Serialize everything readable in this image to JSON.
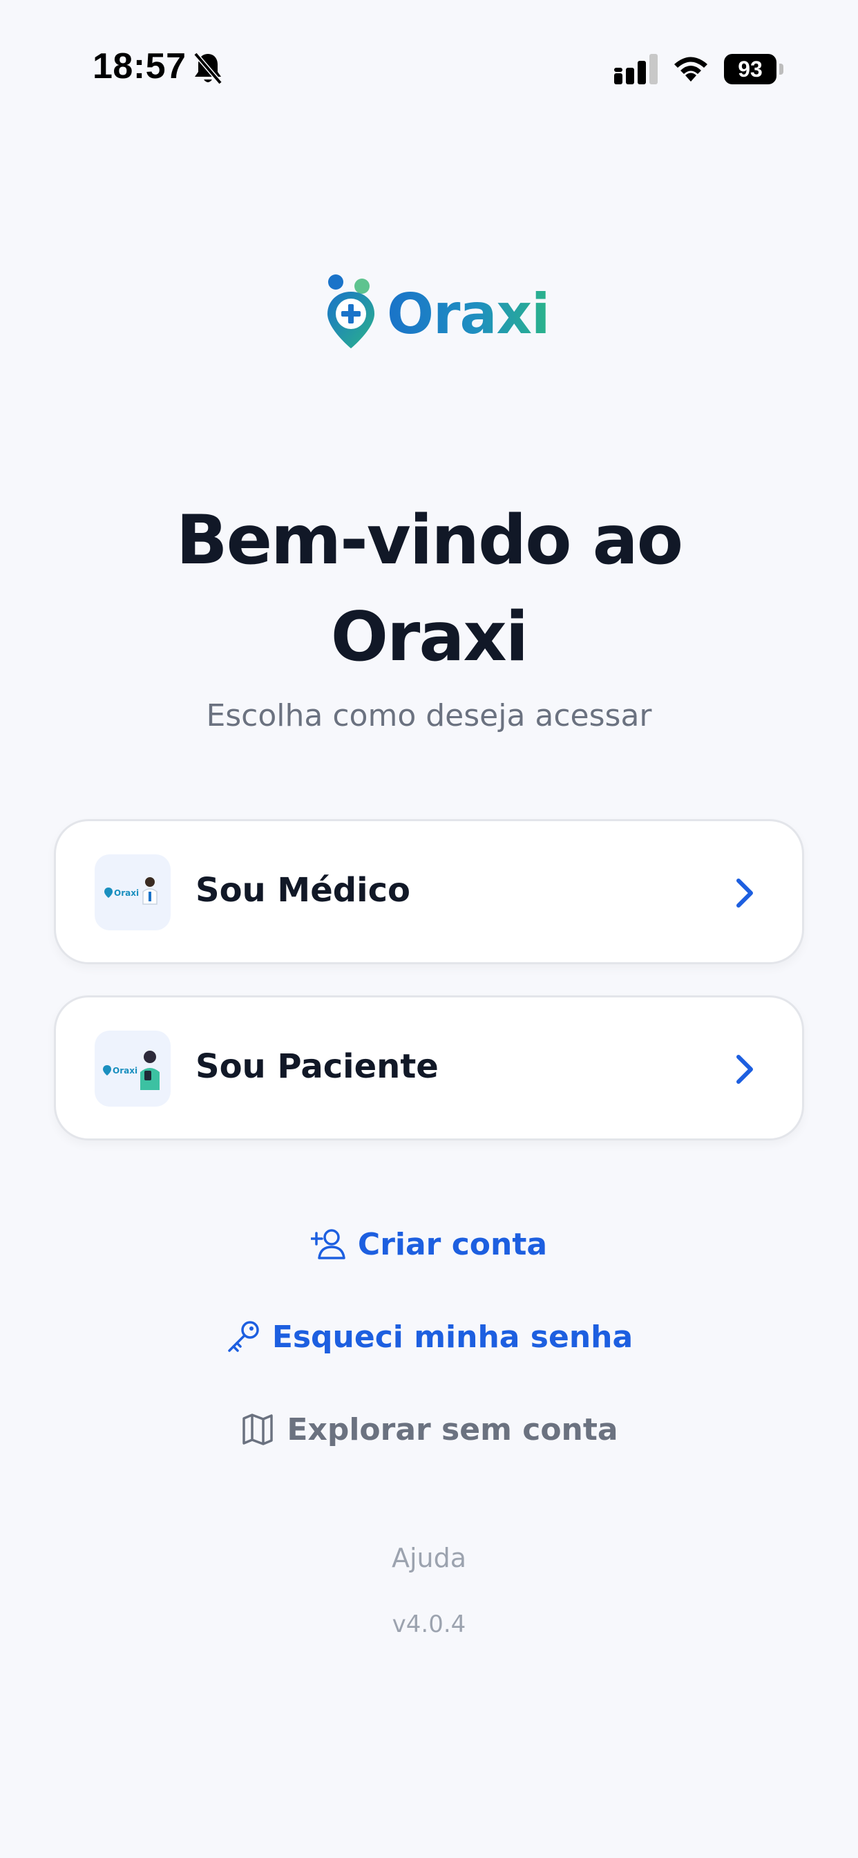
{
  "status_bar": {
    "time": "18:57",
    "battery": "93",
    "icons": [
      "bell-off-icon",
      "cellular-signal-icon",
      "wifi-icon",
      "battery-icon"
    ]
  },
  "brand": {
    "name": "Oraxi",
    "logo_icon": "location-pin-plus-icon",
    "colors": {
      "primary": "#1a73c9",
      "accent": "#2bb38a"
    }
  },
  "welcome": {
    "title_line1": "Bem-vindo ao",
    "title_line2": "Oraxi",
    "subtitle": "Escolha como deseja acessar"
  },
  "options": [
    {
      "label": "Sou Médico",
      "icon": "doctor-illustration",
      "chevron": "chevron-right-icon"
    },
    {
      "label": "Sou Paciente",
      "icon": "patient-illustration",
      "chevron": "chevron-right-icon"
    }
  ],
  "links": {
    "create_account": {
      "label": "Criar conta",
      "icon": "user-plus-icon"
    },
    "forgot_password": {
      "label": "Esqueci minha senha",
      "icon": "key-icon"
    },
    "explore": {
      "label": "Explorar sem conta",
      "icon": "map-icon"
    }
  },
  "footer": {
    "help": "Ajuda",
    "version": "v4.0.4"
  },
  "colors": {
    "background": "#f7f8fc",
    "link_blue": "#1d5fe0",
    "muted": "#6b7280"
  }
}
